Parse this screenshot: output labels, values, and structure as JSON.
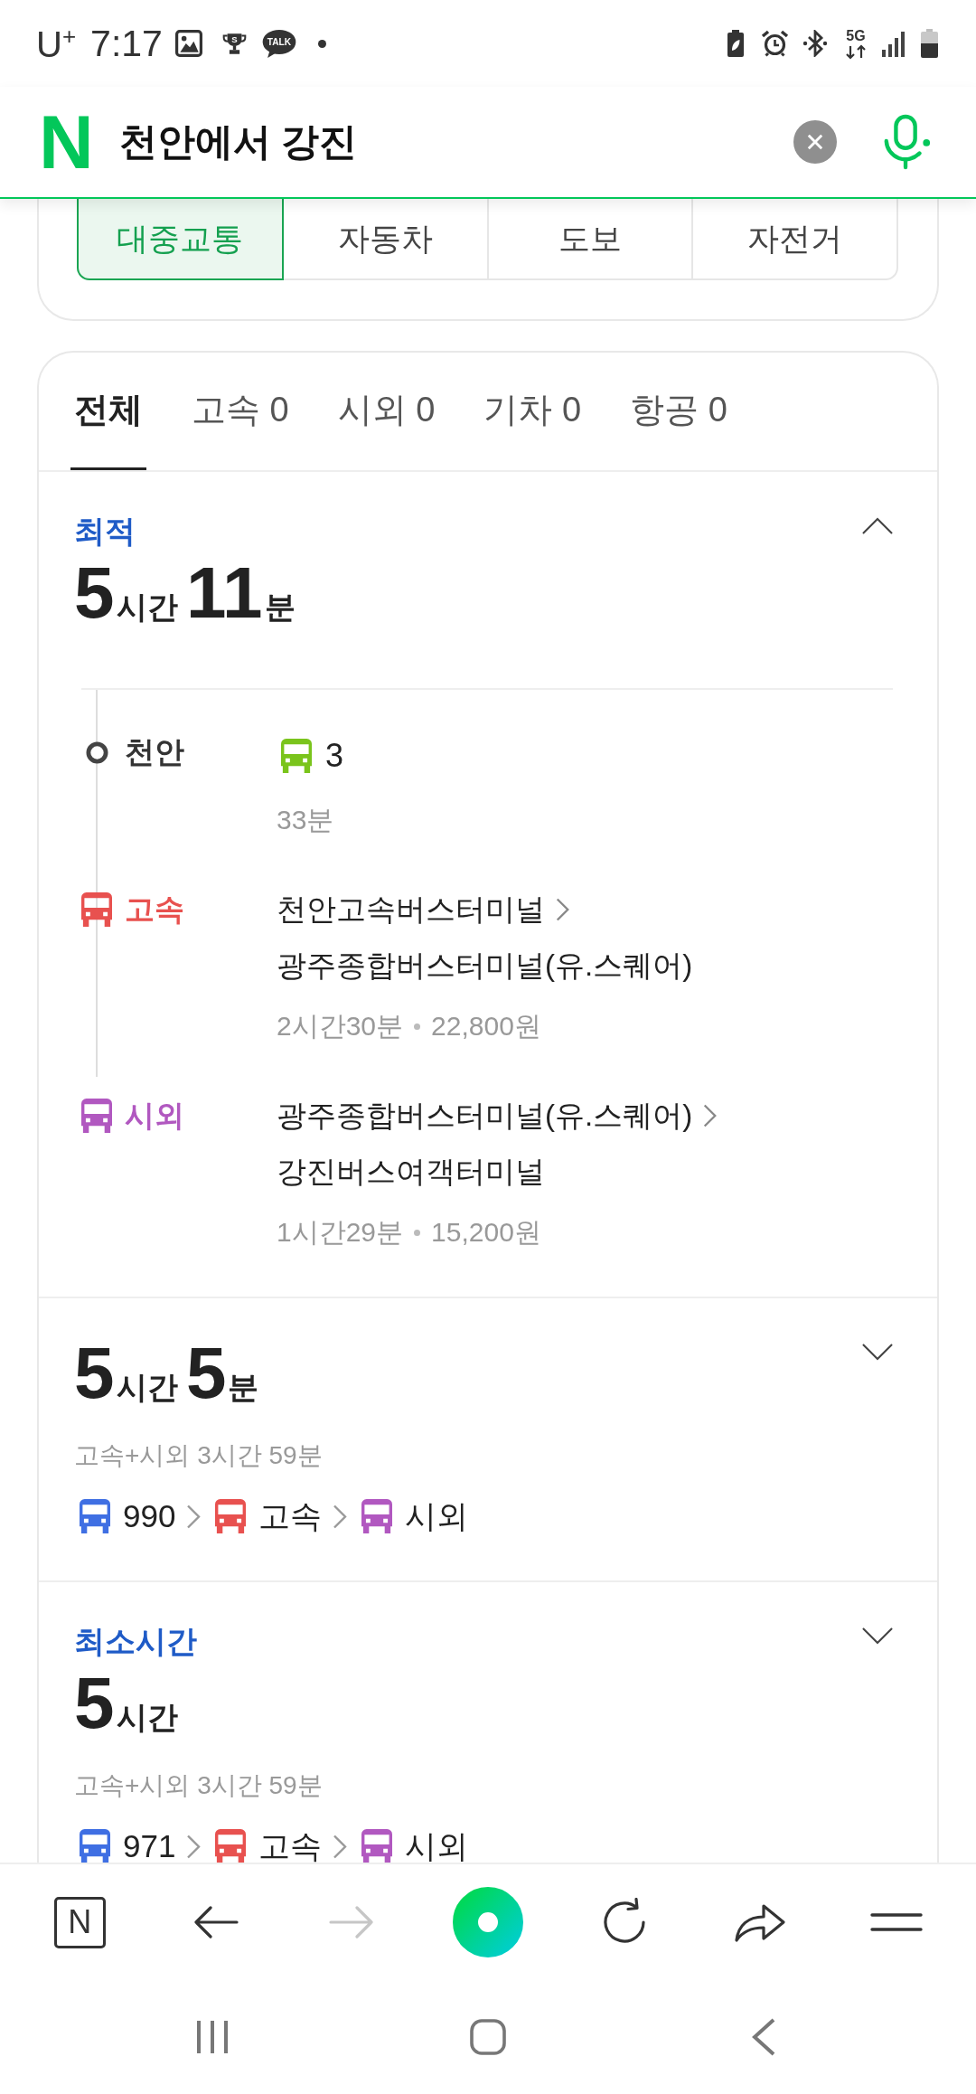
{
  "status_bar": {
    "carrier": "U$^{+}$",
    "time": "7:17",
    "trophy_label": "S",
    "chat_label": "TALK",
    "network_label": "5G"
  },
  "search": {
    "logo": "N",
    "value": "천안에서 강진"
  },
  "mode_tabs": [
    {
      "label": "대중교통",
      "selected": true
    },
    {
      "label": "자동차",
      "selected": false
    },
    {
      "label": "도보",
      "selected": false
    },
    {
      "label": "자전거",
      "selected": false
    }
  ],
  "filter_tabs": [
    {
      "label": "전체",
      "selected": true
    },
    {
      "label": "고속",
      "count": "0",
      "selected": false
    },
    {
      "label": "시외",
      "count": "0",
      "selected": false
    },
    {
      "label": "기차",
      "count": "0",
      "selected": false
    },
    {
      "label": "항공",
      "count": "0",
      "selected": false
    }
  ],
  "routes": [
    {
      "tag": "최적",
      "duration": [
        {
          "value": "5",
          "unit": "시간"
        },
        {
          "value": "11",
          "unit": "분"
        }
      ],
      "expanded": true,
      "steps": [
        {
          "kind": "origin",
          "place": "천안",
          "line": {
            "label": "3",
            "color": "#7ac41c"
          },
          "duration": "33분"
        },
        {
          "kind": "leg",
          "label": "고속",
          "color": "#e8514f",
          "from": "천안고속버스터미널",
          "to": "광주종합버스터미널(유.스퀘어)",
          "duration": "2시간30분",
          "fare": "22,800원"
        },
        {
          "kind": "leg",
          "label": "시외",
          "color": "#b158c0",
          "from": "광주종합버스터미널(유.스퀘어)",
          "to": "강진버스여객터미널",
          "duration": "1시간29분",
          "fare": "15,200원"
        }
      ]
    },
    {
      "duration": [
        {
          "value": "5",
          "unit": "시간"
        },
        {
          "value": "5",
          "unit": "분"
        }
      ],
      "expanded": false,
      "summary": "고속+시외 3시간 59분",
      "legs": [
        {
          "label": "990",
          "color": "#3f6fe3"
        },
        {
          "label": "고속",
          "color": "#e8514f"
        },
        {
          "label": "시외",
          "color": "#b158c0"
        }
      ]
    },
    {
      "tag": "최소시간",
      "duration": [
        {
          "value": "5",
          "unit": "시간"
        }
      ],
      "expanded": false,
      "summary": "고속+시외 3시간 59분",
      "legs": [
        {
          "label": "971",
          "color": "#3f6fe3"
        },
        {
          "label": "고속",
          "color": "#e8514f"
        },
        {
          "label": "시외",
          "color": "#b158c0"
        }
      ]
    }
  ],
  "toolbar": [
    {
      "kind": "logo",
      "label": "N",
      "disabled": false
    },
    {
      "kind": "back",
      "disabled": false
    },
    {
      "kind": "forward",
      "disabled": true
    },
    {
      "kind": "ring",
      "disabled": false
    },
    {
      "kind": "reload",
      "disabled": false
    },
    {
      "kind": "share",
      "disabled": false
    },
    {
      "kind": "menu",
      "disabled": false
    }
  ]
}
